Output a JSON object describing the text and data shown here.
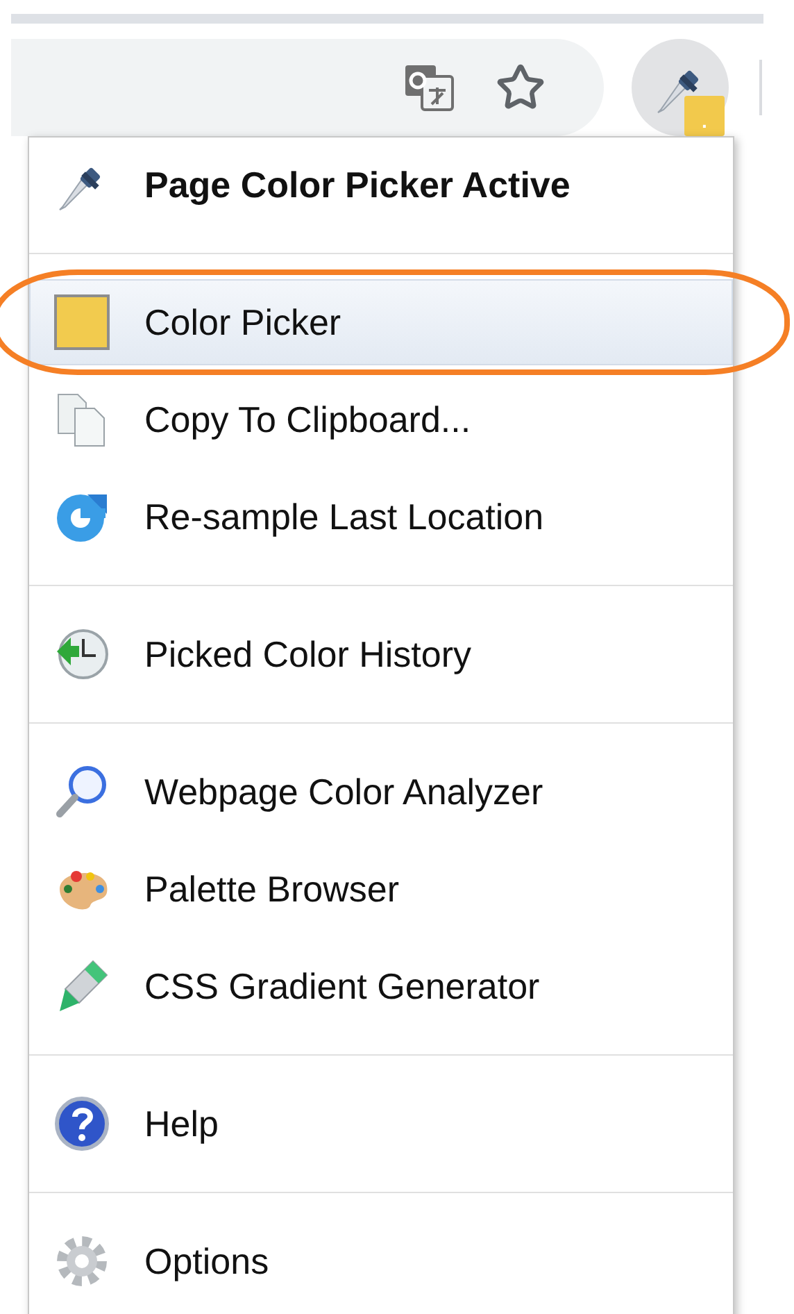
{
  "toolbar": {
    "badge": "."
  },
  "menu": {
    "header": {
      "label": "Page Color Picker Active"
    },
    "sections": [
      {
        "items": [
          {
            "label": "Color Picker",
            "selected": true,
            "circled": true
          },
          {
            "label": "Copy To Clipboard...",
            "selected": false,
            "circled": false
          },
          {
            "label": "Re-sample Last Location",
            "selected": false,
            "circled": false
          }
        ]
      },
      {
        "items": [
          {
            "label": "Picked Color History",
            "selected": false,
            "circled": false
          }
        ]
      },
      {
        "items": [
          {
            "label": "Webpage Color Analyzer",
            "selected": false,
            "circled": false
          },
          {
            "label": "Palette Browser",
            "selected": false,
            "circled": false
          },
          {
            "label": "CSS Gradient Generator",
            "selected": false,
            "circled": false
          }
        ]
      },
      {
        "items": [
          {
            "label": "Help",
            "selected": false,
            "circled": false
          }
        ]
      },
      {
        "items": [
          {
            "label": "Options",
            "selected": false,
            "circled": false
          }
        ]
      }
    ]
  }
}
